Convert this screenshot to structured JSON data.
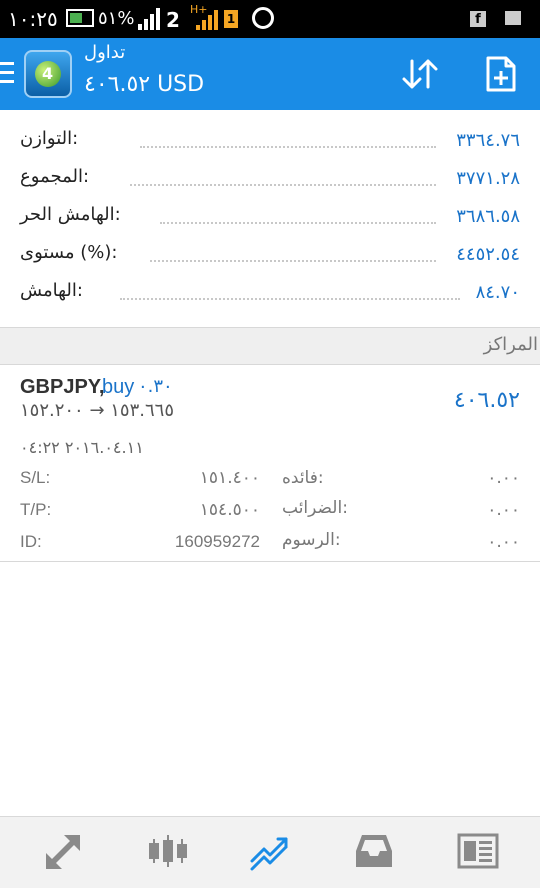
{
  "status_bar": {
    "time": "١٠:٢٥",
    "battery": "٥١%",
    "sim2_label": "2",
    "network_label": "H+",
    "sim1_label": "1"
  },
  "app_bar": {
    "title": "تداول",
    "amount": "٤٠٦.٥٢ USD"
  },
  "account": {
    "rows": [
      {
        "label": "التوازن:",
        "value": "٣٣٦٤.٧٦"
      },
      {
        "label": "المجموع:",
        "value": "٣٧٧١.٢٨"
      },
      {
        "label": "الهامش الحر:",
        "value": "٣٦٨٦.٥٨"
      },
      {
        "label": "مستوى (%):",
        "value": "٤٤٥٢.٥٤"
      },
      {
        "label": "الهامش:",
        "value": "٨٤.٧٠"
      }
    ]
  },
  "positions": {
    "header": "المراكز",
    "items": [
      {
        "symbol": "GBPJPY,",
        "side": "buy",
        "lots": "٠.٣٠",
        "prices": "١٥٣.٦٦٥ → ١٥٢.٢٠٠",
        "profit": "٤٠٦.٥٢",
        "time": "٢٠١٦.٠٤.١١ ٠٤:٢٢",
        "sl_label": "S/L:",
        "sl_value": "١٥١.٤٠٠",
        "tp_label": "T/P:",
        "tp_value": "١٥٤.٥٠٠",
        "id_label": "ID:",
        "id_value": "160959272",
        "swap_label": "فائده:",
        "swap_value": "٠.٠٠",
        "taxes_label": "الضرائب:",
        "taxes_value": "٠.٠٠",
        "commission_label": "الرسوم:",
        "commission_value": "٠.٠٠"
      }
    ]
  },
  "accent_color": "#1a8ce6",
  "tabs": [
    {
      "icon": "quotes-icon"
    },
    {
      "icon": "chart-icon"
    },
    {
      "icon": "trade-icon",
      "active": true
    },
    {
      "icon": "history-icon"
    },
    {
      "icon": "news-icon"
    }
  ]
}
